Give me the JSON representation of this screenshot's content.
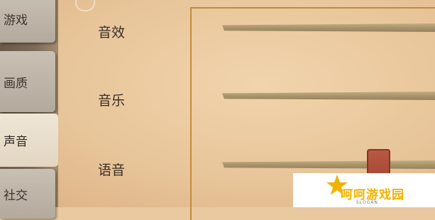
{
  "tabs": [
    {
      "label": "游戏",
      "active": false
    },
    {
      "label": "画质",
      "active": false
    },
    {
      "label": "声音",
      "active": true
    },
    {
      "label": "社交",
      "active": false
    }
  ],
  "settings": [
    {
      "label": "音效"
    },
    {
      "label": "音乐"
    },
    {
      "label": "语音"
    }
  ],
  "watermark": {
    "text": "呵呵游戏园",
    "sub": "SLOGAN"
  },
  "colors": {
    "background": "#e9c9a0",
    "frame": "#c48a3e",
    "track": "#a7926a",
    "handle": "#b85a45",
    "watermark_text": "#f1b300"
  }
}
